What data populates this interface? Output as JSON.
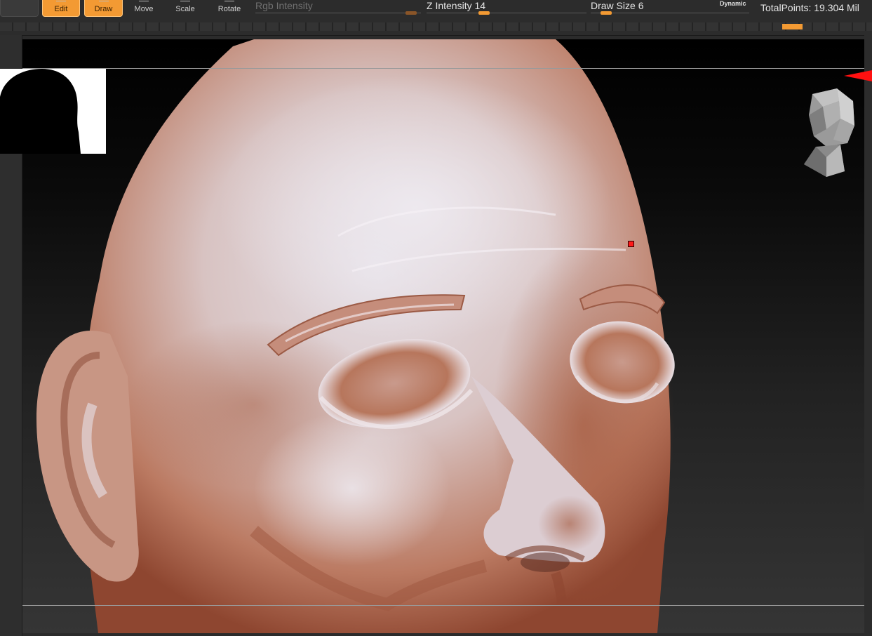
{
  "toolbar": {
    "prev_button_label": "Edit",
    "edit_label": "Edit",
    "draw_label": "Draw",
    "move_label": "Move",
    "scale_label": "Scale",
    "rotate_label": "Rotate",
    "rgb_intensity_label": "Rgb Intensity",
    "z_intensity_label": "Z Intensity",
    "z_intensity_value": "14",
    "draw_size_label": "Draw Size",
    "draw_size_value": "6",
    "dynamic_label": "Dynamic",
    "total_points": "TotalPoints: 19.304 Mil"
  },
  "colors": {
    "accent": "#f39a33",
    "viewport_bg_top": "#000000",
    "viewport_bg_bottom": "#353535",
    "skin_light": "#e3dde4",
    "skin_shadow": "#b5694d",
    "indicator": "#ff1010"
  },
  "icons": {
    "silhouette": "head-silhouette-icon",
    "navigation": "head-navigation-cube-icon",
    "arrow": "red-arrow-indicator-icon"
  }
}
